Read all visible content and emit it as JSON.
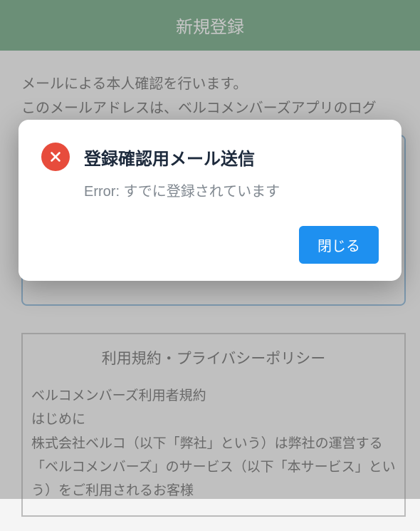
{
  "header": {
    "title": "新規登録"
  },
  "intro": {
    "line1": "メールによる本人確認を行います。",
    "line2": "このメールアドレスは、ベルコメンバーズアプリのログ"
  },
  "terms": {
    "title": "利用規約・プライバシーポリシー",
    "body_line1": "ベルコメンバーズ利用者規約",
    "body_line2": "はじめに",
    "body_line3": "株式会社ベルコ（以下「弊社」という）は弊社の運営する「ベルコメンバーズ」のサービス（以下「本サービス」という）をご利用されるお客様"
  },
  "dialog": {
    "title": "登録確認用メール送信",
    "message": "Error: すでに登録されています",
    "close_label": "閉じる"
  },
  "icons": {
    "error_x": "close-x"
  },
  "colors": {
    "header_bg": "#5a9b6f",
    "error_bg": "#e74c3c",
    "button_bg": "#1e90f0",
    "input_border": "#7aaed6"
  }
}
